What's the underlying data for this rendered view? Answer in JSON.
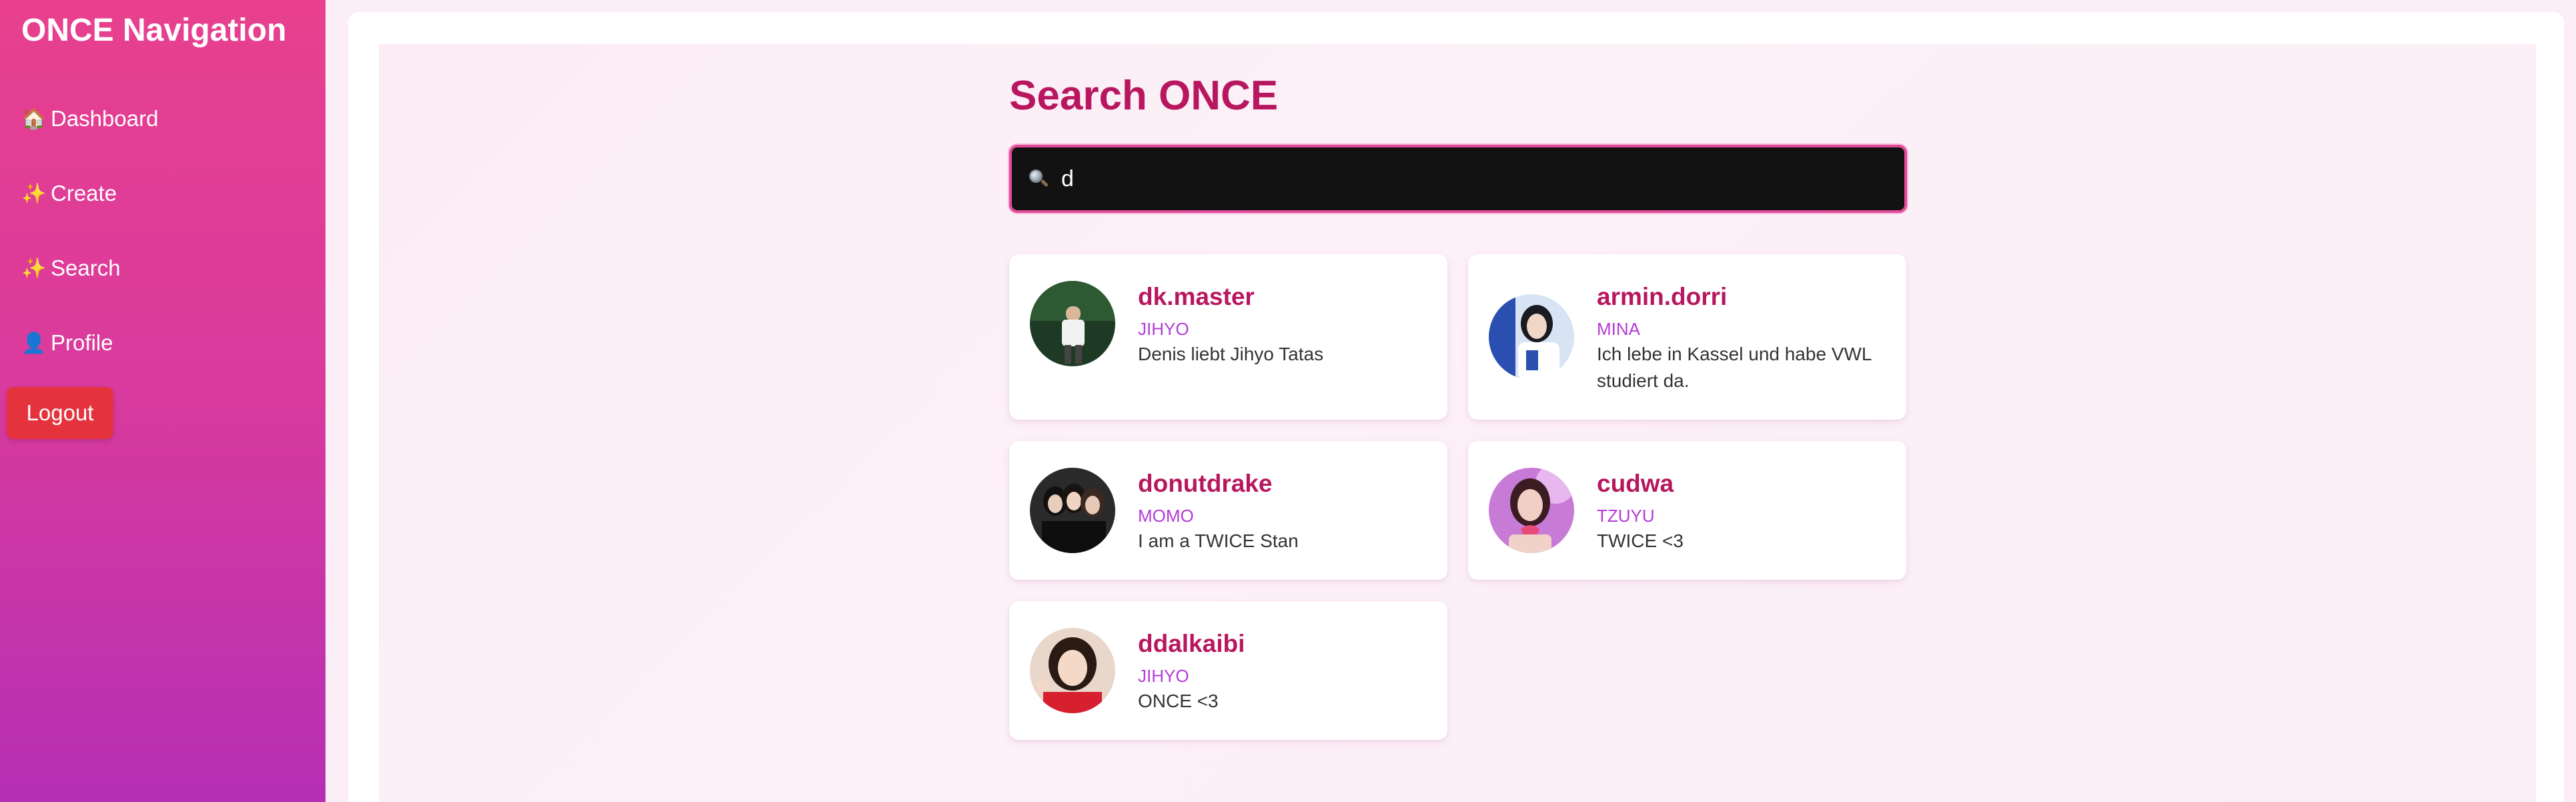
{
  "sidebar": {
    "title": "ONCE Navigation",
    "items": [
      {
        "label": "Dashboard",
        "icon": "🏠",
        "icon_name": "house-icon"
      },
      {
        "label": "Create",
        "icon": "✨",
        "icon_name": "sparkles-icon"
      },
      {
        "label": "Search",
        "icon": "✨",
        "icon_name": "sparkles-icon"
      },
      {
        "label": "Profile",
        "icon": "👤",
        "icon_name": "user-silhouette-icon"
      }
    ],
    "logout_label": "Logout"
  },
  "search": {
    "title": "Search ONCE",
    "query": "d",
    "icon_name": "magnifying-glass-icon"
  },
  "results": [
    {
      "username": "dk.master",
      "bias": "JIHYO",
      "bio": "Denis liebt Jihyo Tatas"
    },
    {
      "username": "armin.dorri",
      "bias": "MINA",
      "bio": "Ich lebe in Kassel und habe VWL studiert da."
    },
    {
      "username": "donutdrake",
      "bias": "MOMO",
      "bio": "I am a TWICE Stan"
    },
    {
      "username": "cudwa",
      "bias": "TZUYU",
      "bio": "TWICE <3"
    },
    {
      "username": "ddalkaibi",
      "bias": "JIHYO",
      "bio": "ONCE <3"
    }
  ],
  "colors": {
    "sidebar_top": "#e8408e",
    "sidebar_bottom": "#b52fb4",
    "accent": "#b8175f",
    "bias": "#b53bd6",
    "logout": "#e5333d",
    "search_bg": "#121212",
    "search_border": "#e24a9a"
  }
}
